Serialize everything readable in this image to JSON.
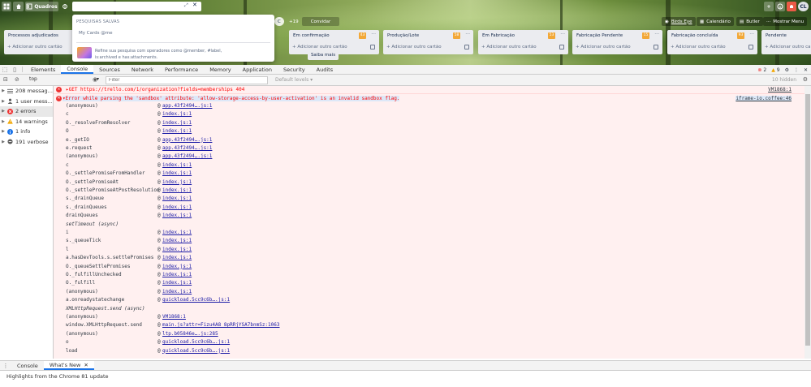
{
  "trello": {
    "boards_label": "Quadros",
    "search_placeholder": "",
    "dropdown": {
      "title": "PESQUISAS SALVAS",
      "saved_search": "My Cards @me",
      "description": "Refine sua pesquisa com operadores como @member, #label, is:archived e has:attachments.",
      "learn_more": "Saiba mais"
    },
    "board_bar": {
      "members_count": "+19",
      "invite": "Convidar",
      "butler_user": "Birds Eye",
      "calendar": "Calendário",
      "butler": "Butler",
      "show_menu": "Mostrar Menu"
    },
    "lists": [
      {
        "title": "Processos adjudicados",
        "count": "",
        "add": "+ Adicionar outro cartão"
      },
      {
        "title": "Em confirmação",
        "count": "43",
        "add": "+ Adicionar outro cartão"
      },
      {
        "title": "Produção/Lote",
        "count": "58",
        "add": "+ Adicionar outro cartão"
      },
      {
        "title": "Em Fabricação",
        "count": "53",
        "add": "+ Adicionar outro cartão"
      },
      {
        "title": "Fabricação Pendente",
        "count": "15",
        "add": "+ Adicionar outro cartão"
      },
      {
        "title": "Fabricação concluída",
        "count": "93",
        "add": "+ Adicionar outro cartão"
      },
      {
        "title": "Pendente",
        "count": "",
        "add": "+ Adicionar outro cartão"
      }
    ],
    "accent": "#2f75b5"
  },
  "devtools": {
    "tabs": [
      "Elements",
      "Console",
      "Sources",
      "Network",
      "Performance",
      "Memory",
      "Application",
      "Security",
      "Audits"
    ],
    "active_tab": "Console",
    "error_count": "2",
    "warning_count": "9",
    "context": "top",
    "filter_placeholder": "Filter",
    "levels": "Default levels ▾",
    "hidden": "10 hidden",
    "sidebar": [
      {
        "label": "208 messag...",
        "icon": "list-icon"
      },
      {
        "label": "1 user mess...",
        "icon": "user-icon"
      },
      {
        "label": "2 errors",
        "icon": "error-icon"
      },
      {
        "label": "14 warnings",
        "icon": "warning-icon"
      },
      {
        "label": "1 info",
        "icon": "info-icon"
      },
      {
        "label": "191 verbose",
        "icon": "verbose-icon"
      }
    ],
    "get_error": {
      "text": "▸GET https://trello.com/1/organization?fields=memberships 404",
      "source": "VM1868:1"
    },
    "sandbox_error": {
      "text": "▾Error while parsing the 'sandbox' attribute: 'allow-storage-access-by-user-activation' is an invalid sandbox flag.",
      "source": "iframe-io.coffee:46"
    },
    "stack": [
      {
        "fn": "(anonymous)",
        "loc": "app.43f2494….js:1"
      },
      {
        "fn": "c",
        "loc": "index.js:1"
      },
      {
        "fn": "O._resolveFromResolver",
        "loc": "index.js:1"
      },
      {
        "fn": "O",
        "loc": "index.js:1"
      },
      {
        "fn": "e._getIO",
        "loc": "app.43f2494….js:1"
      },
      {
        "fn": "e.request",
        "loc": "app.43f2494….js:1"
      },
      {
        "fn": "(anonymous)",
        "loc": "app.43f2494….js:1"
      },
      {
        "fn": "c",
        "loc": "index.js:1"
      },
      {
        "fn": "O._settlePromiseFromHandler",
        "loc": "index.js:1"
      },
      {
        "fn": "O._settlePromiseAt",
        "loc": "index.js:1"
      },
      {
        "fn": "O._settlePromiseAtPostResolution",
        "loc": "index.js:1"
      },
      {
        "fn": "s._drainQueue",
        "loc": "index.js:1"
      },
      {
        "fn": "s._drainQueues",
        "loc": "index.js:1"
      },
      {
        "fn": "drainQueues",
        "loc": "index.js:1"
      },
      {
        "fn": "setTimeout (async)",
        "loc": "",
        "async": true
      },
      {
        "fn": "i",
        "loc": "index.js:1"
      },
      {
        "fn": "s._queueTick",
        "loc": "index.js:1"
      },
      {
        "fn": "l",
        "loc": "index.js:1"
      },
      {
        "fn": "a.hasDevTools.s.settlePromises",
        "loc": "index.js:1"
      },
      {
        "fn": "O._queueSettlePromises",
        "loc": "index.js:1"
      },
      {
        "fn": "O._fulfillUnchecked",
        "loc": "index.js:1"
      },
      {
        "fn": "O._fulfill",
        "loc": "index.js:1"
      },
      {
        "fn": "(anonymous)",
        "loc": "index.js:1"
      },
      {
        "fn": "a.onreadystatechange",
        "loc": "quickload.5cc9c6b….js:1"
      },
      {
        "fn": "XMLHttpRequest.send (async)",
        "loc": "",
        "async": true
      },
      {
        "fn": "(anonymous)",
        "loc": "VM1868:1"
      },
      {
        "fn": "window.XMLHttpRequest.send",
        "loc": "main.js?attr=Fizu4A8_8pRRjYSA7bnmSz:1063"
      },
      {
        "fn": "(anonymous)",
        "loc": "ltp.b05846e….js:285"
      },
      {
        "fn": "o",
        "loc": "quickload.5cc9c6b….js:1"
      },
      {
        "fn": "load",
        "loc": "quickload.5cc9c6b….js:1"
      }
    ],
    "drawer": {
      "tabs": [
        "Console",
        "What's New"
      ],
      "active": "What's New",
      "highlight": "Highlights from the Chrome 81 update"
    }
  }
}
